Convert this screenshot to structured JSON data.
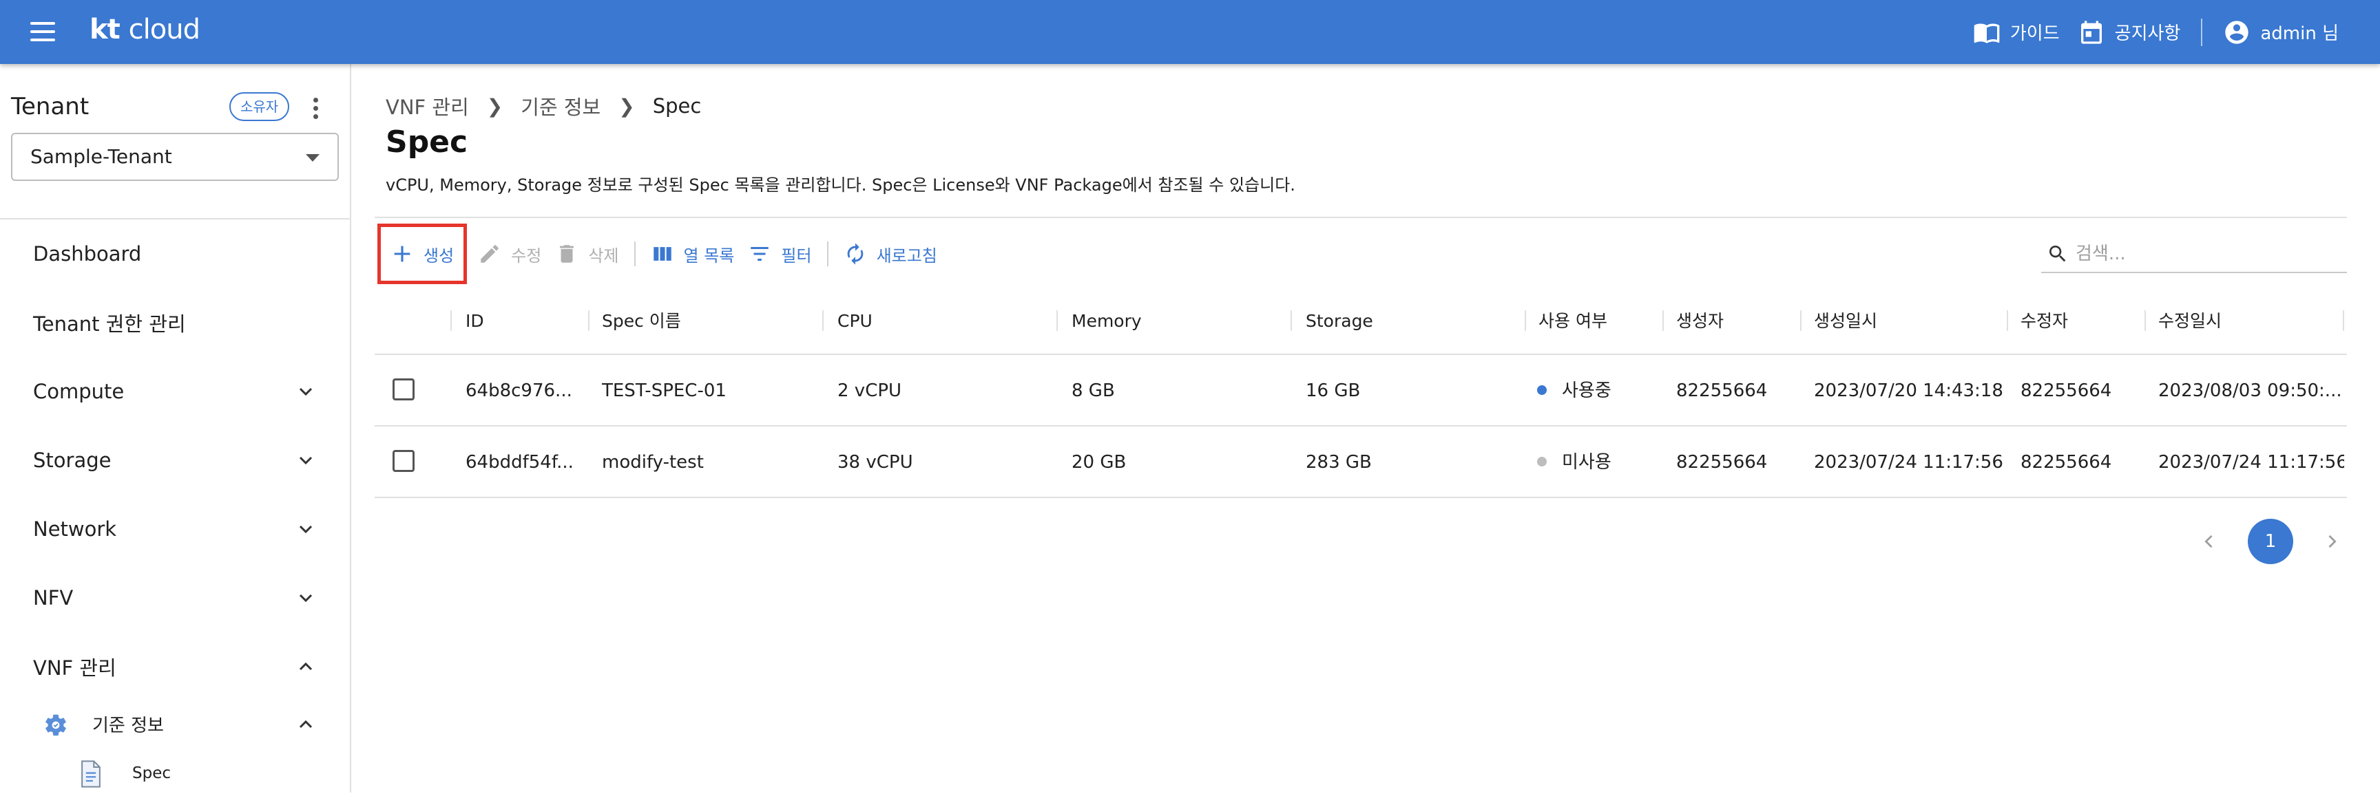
{
  "header": {
    "brand_kt": "kt",
    "brand_cloud": "cloud",
    "guide_label": "가이드",
    "notice_label": "공지사항",
    "user_label": "admin 님"
  },
  "sidebar": {
    "tenant_title": "Tenant",
    "owner_badge": "소유자",
    "tenant_selected": "Sample-Tenant",
    "nav": [
      {
        "label": "Dashboard"
      },
      {
        "label": "Tenant 권한 관리"
      },
      {
        "label": "Compute"
      },
      {
        "label": "Storage"
      },
      {
        "label": "Network"
      },
      {
        "label": "NFV"
      },
      {
        "label": "VNF 관리"
      }
    ],
    "sub_group": "기준 정보",
    "sub_item": "Spec"
  },
  "breadcrumb": [
    "VNF 관리",
    "기준 정보",
    "Spec"
  ],
  "page": {
    "title": "Spec",
    "description": "vCPU, Memory, Storage 정보로 구성된 Spec 목록을 관리합니다. Spec은 License와 VNF Package에서 참조될 수 있습니다."
  },
  "toolbar": {
    "create": "생성",
    "edit": "수정",
    "delete": "삭제",
    "columns": "열 목록",
    "filter": "필터",
    "refresh": "새로고침"
  },
  "search": {
    "placeholder": "검색..."
  },
  "table": {
    "columns": [
      "ID",
      "Spec 이름",
      "CPU",
      "Memory",
      "Storage",
      "사용 여부",
      "생성자",
      "생성일시",
      "수정자",
      "수정일시"
    ],
    "rows": [
      {
        "id": "64b8c976...",
        "name": "TEST-SPEC-01",
        "cpu": "2 vCPU",
        "memory": "8 GB",
        "storage": "16 GB",
        "status": "사용중",
        "status_color": "#3a78d1",
        "creator": "82255664",
        "created_at": "2023/07/20 14:43:18",
        "modifier": "82255664",
        "modified_at": "2023/08/03 09:50:..."
      },
      {
        "id": "64bddf54f...",
        "name": "modify-test",
        "cpu": "38 vCPU",
        "memory": "20 GB",
        "storage": "283 GB",
        "status": "미사용",
        "status_color": "#bdbdbd",
        "creator": "82255664",
        "created_at": "2023/07/24 11:17:56",
        "modifier": "82255664",
        "modified_at": "2023/07/24 11:17:56"
      }
    ]
  },
  "pagination": {
    "current_page": "1"
  },
  "colors": {
    "primary": "#3a78d1",
    "highlight": "#e5352b"
  }
}
